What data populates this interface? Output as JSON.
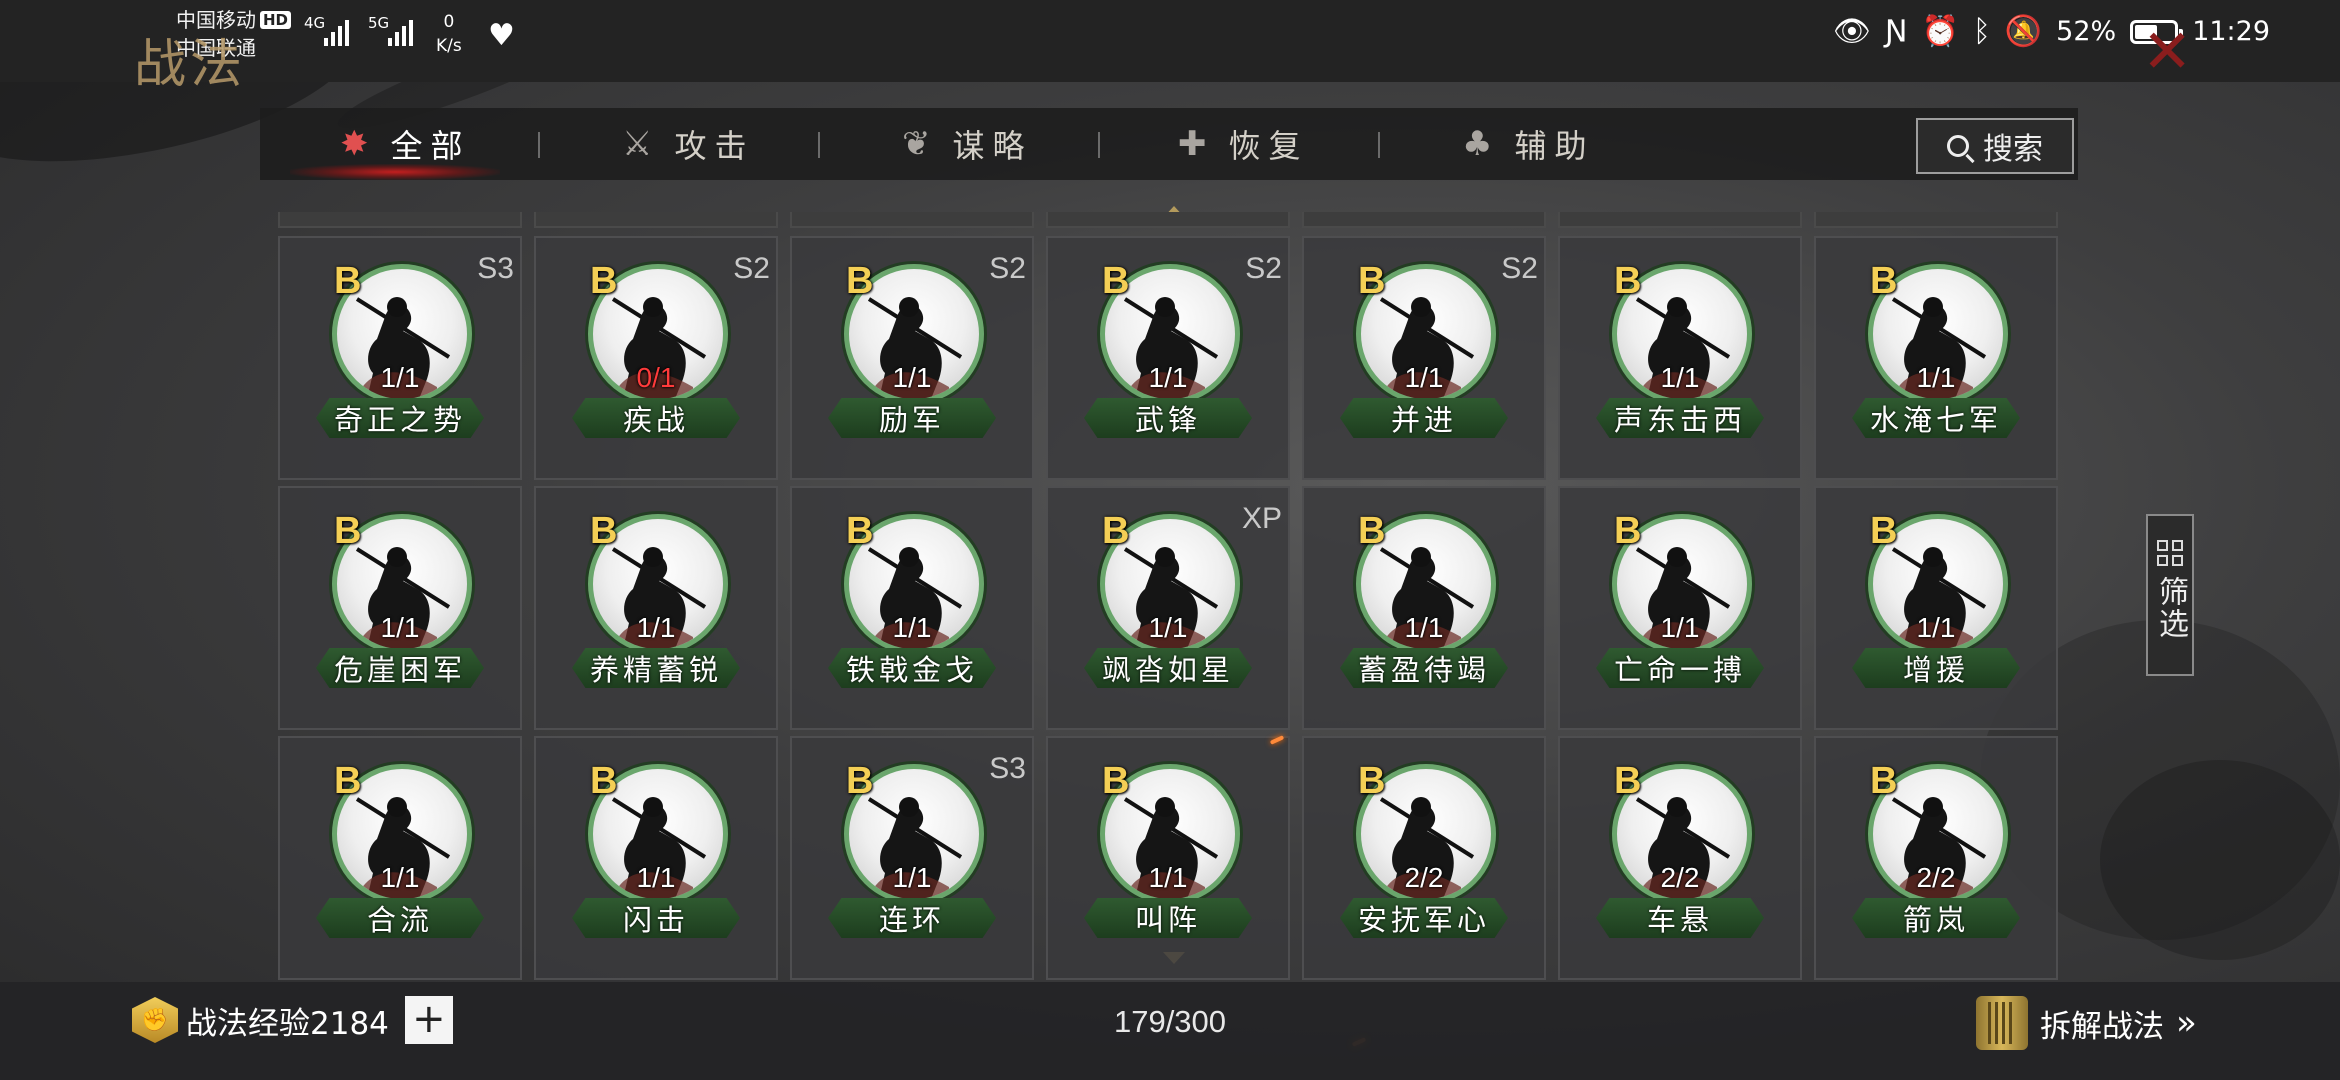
{
  "status_bar": {
    "carrier1": "中国移动",
    "hd": "HD",
    "carrier2": "中国联通",
    "sig1": "4G",
    "sig2": "5G",
    "net_speed_value": "0",
    "net_speed_unit": "K/s",
    "battery": "52%",
    "time": "11:29"
  },
  "page": {
    "title": "战法"
  },
  "tabs": [
    {
      "label": "全部",
      "icon": "all-icon",
      "active": true
    },
    {
      "label": "攻击",
      "icon": "crossed-swords-icon",
      "active": false
    },
    {
      "label": "谋略",
      "icon": "fan-icon",
      "active": false
    },
    {
      "label": "恢复",
      "icon": "recover-icon",
      "active": false
    },
    {
      "label": "辅助",
      "icon": "pouch-icon",
      "active": false
    }
  ],
  "search": {
    "label": "搜索"
  },
  "cards": [
    {
      "grade": "B",
      "season": "S3",
      "count": "1/1",
      "name": "奇正之势"
    },
    {
      "grade": "B",
      "season": "S2",
      "count": "0/1",
      "name": "疾战",
      "count_zero": true
    },
    {
      "grade": "B",
      "season": "S2",
      "count": "1/1",
      "name": "励军"
    },
    {
      "grade": "B",
      "season": "S2",
      "count": "1/1",
      "name": "武锋"
    },
    {
      "grade": "B",
      "season": "S2",
      "count": "1/1",
      "name": "并进"
    },
    {
      "grade": "B",
      "season": "",
      "count": "1/1",
      "name": "声东击西"
    },
    {
      "grade": "B",
      "season": "",
      "count": "1/1",
      "name": "水淹七军"
    },
    {
      "grade": "B",
      "season": "",
      "count": "1/1",
      "name": "危崖困军"
    },
    {
      "grade": "B",
      "season": "",
      "count": "1/1",
      "name": "养精蓄锐"
    },
    {
      "grade": "B",
      "season": "",
      "count": "1/1",
      "name": "铁戟金戈"
    },
    {
      "grade": "B",
      "season": "XP",
      "count": "1/1",
      "name": "飒沓如星"
    },
    {
      "grade": "B",
      "season": "",
      "count": "1/1",
      "name": "蓄盈待竭"
    },
    {
      "grade": "B",
      "season": "",
      "count": "1/1",
      "name": "亡命一搏"
    },
    {
      "grade": "B",
      "season": "",
      "count": "1/1",
      "name": "增援"
    },
    {
      "grade": "B",
      "season": "",
      "count": "1/1",
      "name": "合流"
    },
    {
      "grade": "B",
      "season": "",
      "count": "1/1",
      "name": "闪击"
    },
    {
      "grade": "B",
      "season": "S3",
      "count": "1/1",
      "name": "连环"
    },
    {
      "grade": "B",
      "season": "",
      "count": "1/1",
      "name": "叫阵"
    },
    {
      "grade": "B",
      "season": "",
      "count": "2/2",
      "name": "安抚军心"
    },
    {
      "grade": "B",
      "season": "",
      "count": "2/2",
      "name": "车悬"
    },
    {
      "grade": "B",
      "season": "",
      "count": "2/2",
      "name": "箭岚"
    }
  ],
  "filter": {
    "label": "筛选"
  },
  "bottom": {
    "exp_label": "战法经验2184",
    "plus": "+",
    "capacity": "179/300",
    "dismantle_label": "拆解战法",
    "dismantle_chevron": "»"
  },
  "colors": {
    "grade_gold": "#f4cf55",
    "active_tab_red": "#c21f1f",
    "nameplate_green": "#2f5a30",
    "zero_count_red": "#ff3b3b"
  }
}
